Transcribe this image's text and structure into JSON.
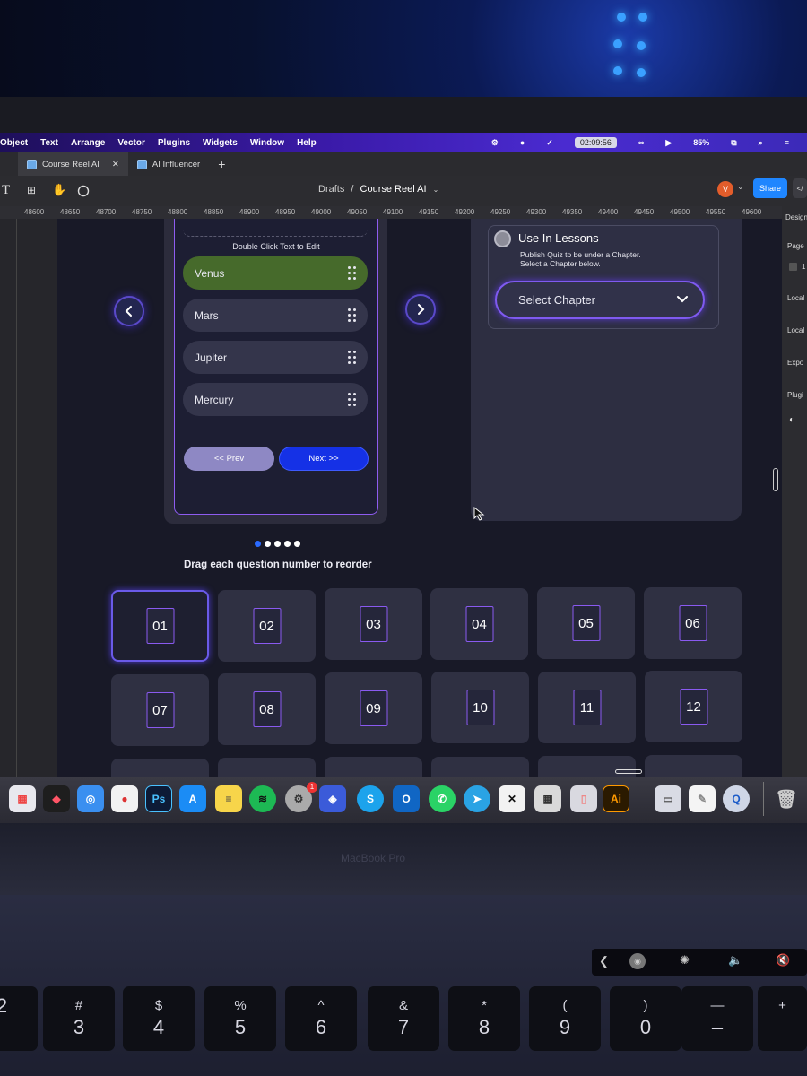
{
  "menubar": {
    "items": [
      "Object",
      "Text",
      "Arrange",
      "Vector",
      "Plugins",
      "Widgets",
      "Window",
      "Help"
    ],
    "clock": "02:09:56",
    "battery": "85%"
  },
  "tabs": [
    {
      "label": "Course Reel AI",
      "active": true
    },
    {
      "label": "AI Influencer",
      "active": false
    }
  ],
  "toolbar": {
    "breadcrumb_root": "Drafts",
    "breadcrumb_sep": "/",
    "breadcrumb_file": "Course Reel AI",
    "avatar_initial": "V",
    "share_label": "Share"
  },
  "ruler": {
    "ticks": [
      "48600",
      "48650",
      "48700",
      "48750",
      "48800",
      "48850",
      "48900",
      "48950",
      "49000",
      "49050",
      "49100",
      "49150",
      "49200",
      "49250",
      "49300",
      "49350",
      "49400",
      "49450",
      "49500",
      "49550",
      "49600"
    ]
  },
  "right_panel": {
    "items": [
      "Design",
      "Page",
      "1",
      "Local",
      "Local",
      "Expo",
      "Plugi"
    ]
  },
  "quiz": {
    "hint": "Double Click Text to Edit",
    "options": [
      "Venus",
      "Mars",
      "Jupiter",
      "Mercury"
    ],
    "selected_index": 0,
    "prev_label": "<< Prev",
    "next_label": "Next >>"
  },
  "lessons": {
    "title": "Use In Lessons",
    "subtitle_line1": "Publish Quiz to be under a Chapter.",
    "subtitle_line2": "Select a Chapter below.",
    "select_placeholder": "Select Chapter"
  },
  "pagination": {
    "total": 5,
    "current": 0
  },
  "reorder": {
    "label": "Drag each question number to reorder",
    "numbers": [
      "01",
      "02",
      "03",
      "04",
      "05",
      "06",
      "07",
      "08",
      "09",
      "10",
      "11",
      "12"
    ],
    "selected_index": 0
  },
  "dock": {
    "apps": [
      "launchpad-icon",
      "figma-icon",
      "safari-icon",
      "chrome-icon",
      "photoshop-icon",
      "app-store-icon",
      "notes-icon",
      "spotify-icon",
      "system-settings-icon",
      "proton-icon",
      "skype-icon",
      "outlook-icon",
      "whatsapp-icon",
      "telegram-icon",
      "capcut-icon",
      "calculator-icon",
      "preview-icon",
      "illustrator-icon",
      "finder-window-icon",
      "textedit-icon",
      "quicktime-icon",
      "trash-icon"
    ],
    "ps_label": "Ps",
    "ai_label": "Ai",
    "s_label": "S",
    "settings_badge": "1"
  },
  "laptop": {
    "brand": "MacBook Pro",
    "keys": [
      {
        "top": "",
        "bottom": "2"
      },
      {
        "top": "#",
        "bottom": "3"
      },
      {
        "top": "$",
        "bottom": "4"
      },
      {
        "top": "%",
        "bottom": "5"
      },
      {
        "top": "^",
        "bottom": "6"
      },
      {
        "top": "&",
        "bottom": "7"
      },
      {
        "top": "*",
        "bottom": "8"
      },
      {
        "top": "(",
        "bottom": "9"
      },
      {
        "top": ")",
        "bottom": "0"
      },
      {
        "top": "—",
        "bottom": "–"
      },
      {
        "top": "+",
        "bottom": ""
      }
    ]
  },
  "colors": {
    "accent_purple": "#8e5cf0",
    "next_blue": "#1531e6",
    "selected_option_green": "#466a2b",
    "share_blue": "#1f86ff"
  }
}
